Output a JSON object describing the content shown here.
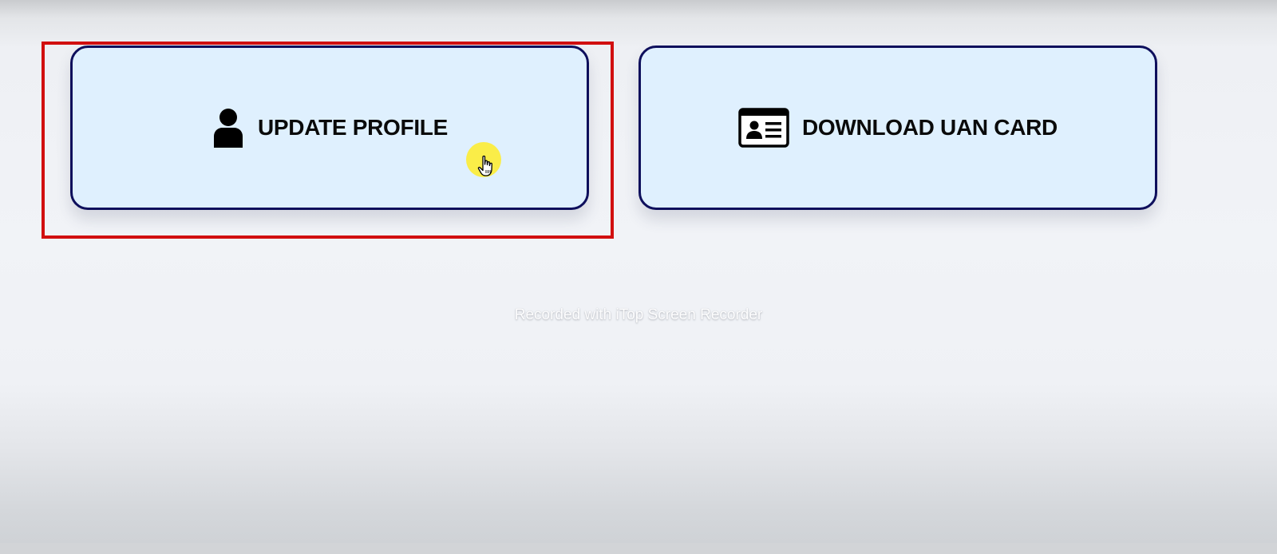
{
  "cards": {
    "update_profile": {
      "label": "UPDATE PROFILE",
      "icon": "user-icon"
    },
    "download_uan_card": {
      "label": "DOWNLOAD UAN CARD",
      "icon": "id-card-icon"
    }
  },
  "overlay": {
    "watermark": "Recorded with iTop Screen Recorder",
    "highlight_color": "#d10f0f",
    "cursor_icon": "hand-pointer-icon"
  },
  "colors": {
    "card_background": "#dff0fe",
    "card_border": "#0e0f5c",
    "label_text": "#0a0a0a",
    "cursor_highlight": "#ffec28"
  }
}
